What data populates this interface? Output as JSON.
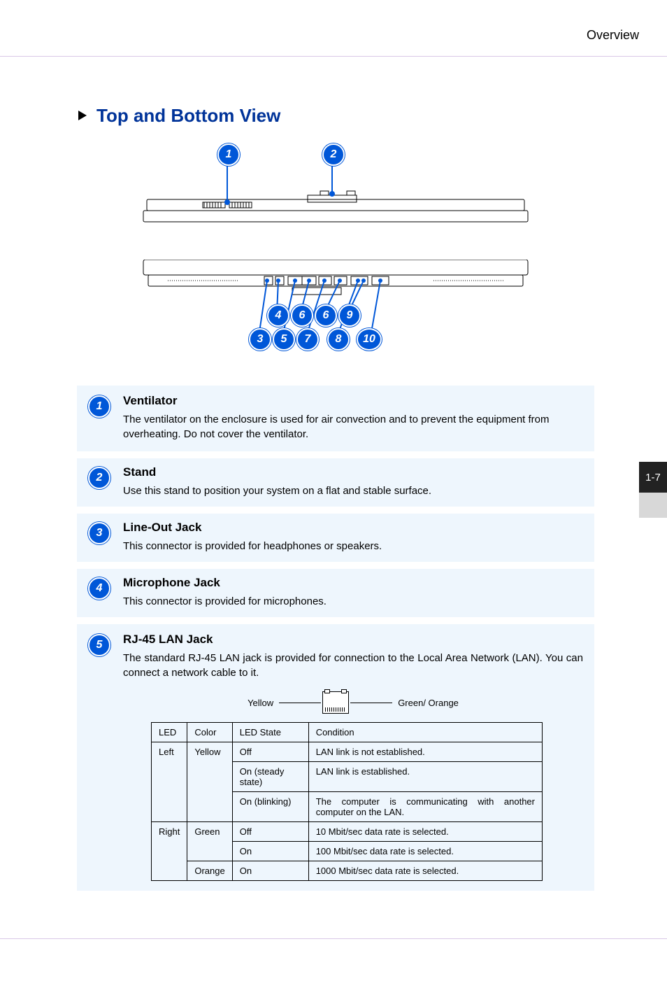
{
  "header": {
    "section": "Overview"
  },
  "page_number": "1-7",
  "title": "Top and Bottom View",
  "callouts": {
    "1": {
      "title": "Ventilator",
      "text": "The ventilator on the enclosure is used for air convection and to prevent the equipment from overheating. Do not cover the ventilator."
    },
    "2": {
      "title": "Stand",
      "text": "Use this stand to position your system on a flat and stable surface."
    },
    "3": {
      "title": "Line-Out Jack",
      "text": "This connector is provided for headphones or speakers."
    },
    "4": {
      "title": "Microphone Jack",
      "text": "This connector is provided for microphones."
    },
    "5": {
      "title": "RJ-45 LAN Jack",
      "text": "The standard RJ-45 LAN jack is provided for connection to the Local Area Network (LAN). You can connect a network cable to it."
    }
  },
  "rj45_diagram": {
    "left_label": "Yellow",
    "right_label": "Green/ Orange"
  },
  "led_table": {
    "headers": {
      "led": "LED",
      "color": "Color",
      "state": "LED State",
      "condition": "Condition"
    },
    "rows": [
      {
        "led": "Left",
        "color": "Yellow",
        "state": "Off",
        "condition": "LAN link is not established."
      },
      {
        "led": "",
        "color": "",
        "state": "On (steady state)",
        "condition": "LAN link is established."
      },
      {
        "led": "",
        "color": "",
        "state": "On (blinking)",
        "condition": "The computer is communicating with another computer on the LAN."
      },
      {
        "led": "Right",
        "color": "Green",
        "state": "Off",
        "condition": "10 Mbit/sec data rate is selected."
      },
      {
        "led": "",
        "color": "",
        "state": "On",
        "condition": "100 Mbit/sec data rate is selected."
      },
      {
        "led": "",
        "color": "Orange",
        "state": "On",
        "condition": "1000 Mbit/sec data rate is selected."
      }
    ]
  },
  "diagram_numbers": [
    "1",
    "2",
    "3",
    "4",
    "5",
    "6",
    "6",
    "7",
    "8",
    "9",
    "10"
  ]
}
